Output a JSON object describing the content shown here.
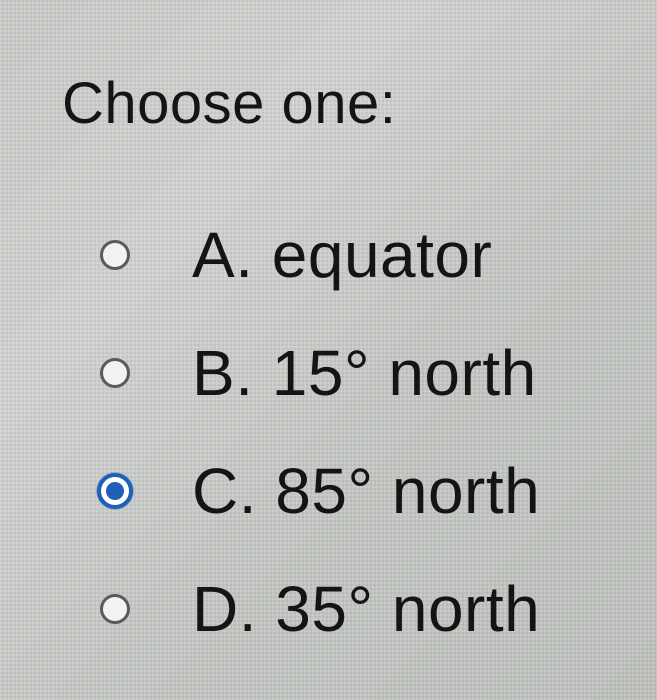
{
  "question": {
    "title": "Choose one:"
  },
  "options": [
    {
      "label": "A. equator",
      "selected": false
    },
    {
      "label": "B. 15° north",
      "selected": false
    },
    {
      "label": "C. 85° north",
      "selected": true
    },
    {
      "label": "D. 35° north",
      "selected": false
    }
  ],
  "colors": {
    "selected_radio": "#1f5fb5",
    "text": "#141414"
  }
}
